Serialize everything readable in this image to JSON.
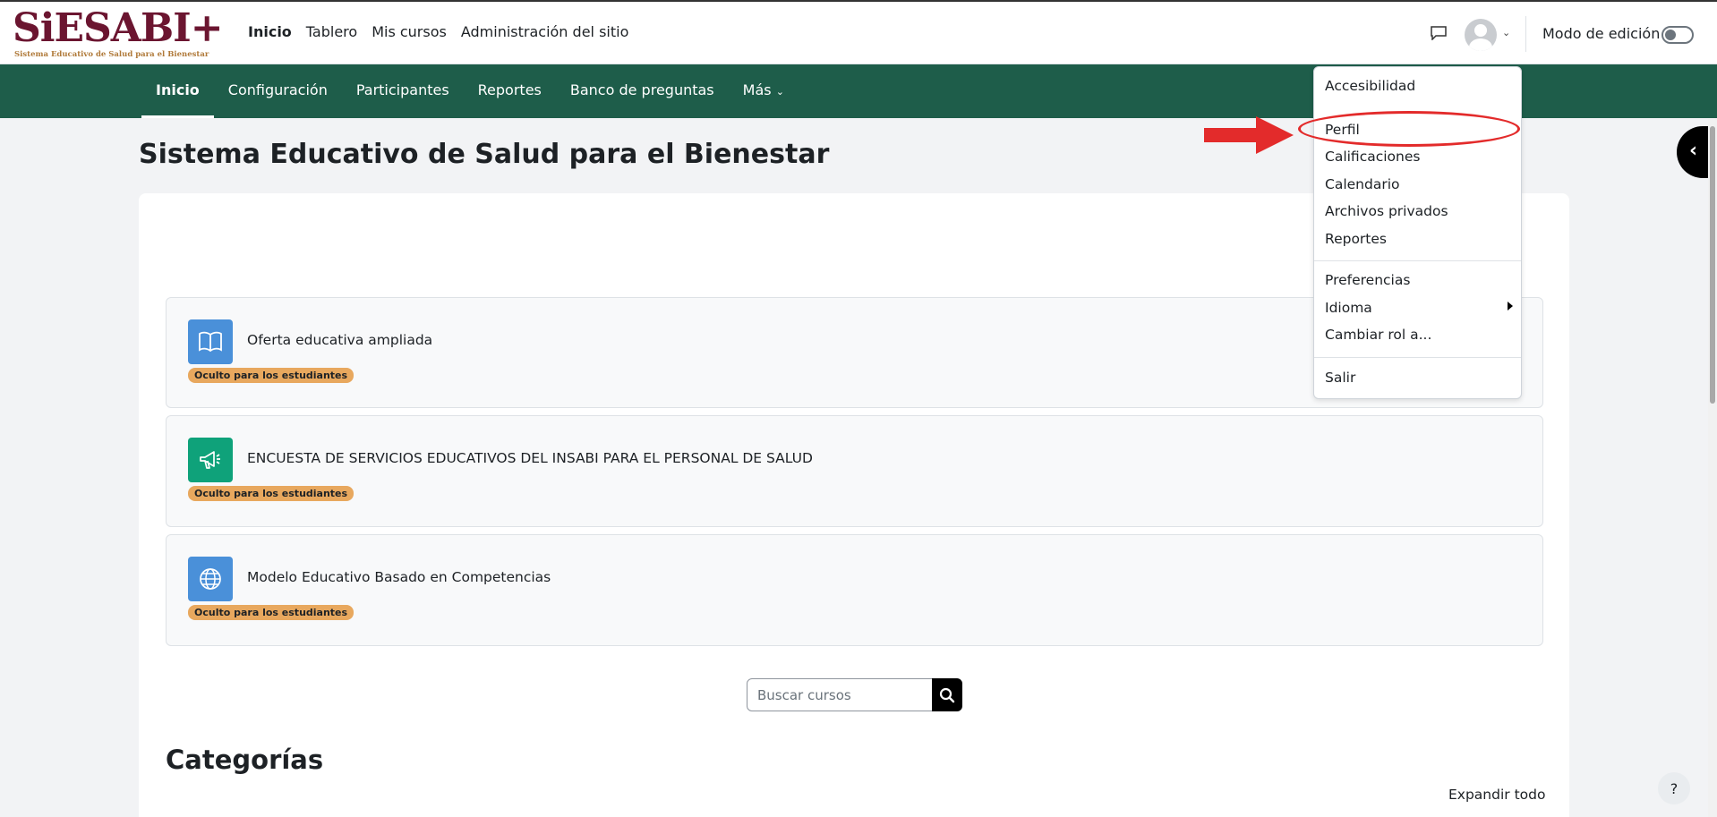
{
  "logo": {
    "main": "SiESABI",
    "plus": "+",
    "sub": "Sistema Educativo de Salud para el Bienestar"
  },
  "topnav": {
    "items": [
      "Inicio",
      "Tablero",
      "Mis cursos",
      "Administración del sitio"
    ]
  },
  "header": {
    "edit_mode_label": "Modo de edición"
  },
  "secnav": {
    "items": [
      "Inicio",
      "Configuración",
      "Participantes",
      "Reportes",
      "Banco de preguntas",
      "Más"
    ]
  },
  "page": {
    "title": "Sistema Educativo de Salud para el Bienestar"
  },
  "activities": [
    {
      "name": "Oferta educativa ampliada",
      "badge": "Oculto para los estudiantes",
      "icon": "book-icon",
      "color": "#4a90d9"
    },
    {
      "name": "ENCUESTA DE SERVICIOS EDUCATIVOS DEL INSABI PARA EL PERSONAL DE SALUD",
      "badge": "Oculto para los estudiantes",
      "icon": "megaphone-icon",
      "color": "#0fa27a"
    },
    {
      "name": "Modelo Educativo Basado en Competencias",
      "badge": "Oculto para los estudiantes",
      "icon": "globe-icon",
      "color": "#4a90d9"
    }
  ],
  "search": {
    "placeholder": "Buscar cursos"
  },
  "categories": {
    "title": "Categorías",
    "expand_all": "Expandir todo"
  },
  "help": {
    "label": "?"
  },
  "user_menu": {
    "items": [
      "Accesibilidad",
      "Perfil",
      "Calificaciones",
      "Calendario",
      "Archivos privados",
      "Reportes",
      "Preferencias",
      "Idioma",
      "Cambiar rol a...",
      "Salir"
    ]
  },
  "colors": {
    "brand": "#6b1530",
    "nav_bg": "#1e5d4a",
    "badge": "#e8a85e",
    "annotation": "#e32b2b"
  }
}
